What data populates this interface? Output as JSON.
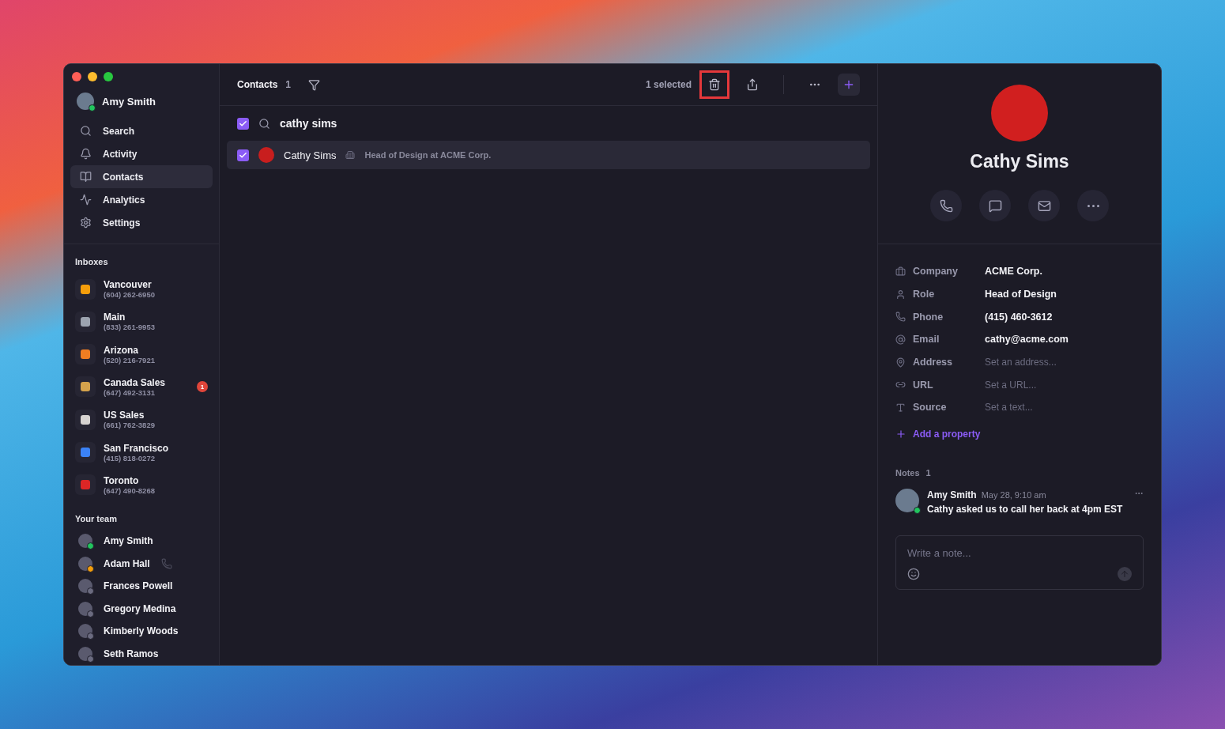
{
  "window": {
    "user": {
      "name": "Amy Smith",
      "online": true
    }
  },
  "sidebar": {
    "items": [
      {
        "kind": "search",
        "label": "Search",
        "selected": false
      },
      {
        "kind": "activity",
        "label": "Activity",
        "selected": false
      },
      {
        "kind": "contacts",
        "label": "Contacts",
        "selected": true
      },
      {
        "kind": "analytics",
        "label": "Analytics",
        "selected": false
      },
      {
        "kind": "settings",
        "label": "Settings",
        "selected": false
      }
    ],
    "inboxes_title": "Inboxes",
    "inboxes": [
      {
        "name": "Vancouver",
        "phone": "(604) 262-6950",
        "color": "#f59e0b"
      },
      {
        "name": "Main",
        "phone": "(833) 261-9953",
        "color": "#9ca3af"
      },
      {
        "name": "Arizona",
        "phone": "(520) 216-7921",
        "color": "#ef7d22"
      },
      {
        "name": "Canada Sales",
        "phone": "(647) 492-3131",
        "color": "#d4a24c",
        "badge": "1"
      },
      {
        "name": "US Sales",
        "phone": "(661) 762-3829",
        "color": "#d6d3d1"
      },
      {
        "name": "San Francisco",
        "phone": "(415) 818-0272",
        "color": "#3b82f6"
      },
      {
        "name": "Toronto",
        "phone": "(647) 490-8268",
        "color": "#dc2626"
      }
    ],
    "team_title": "Your team",
    "team": [
      {
        "name": "Amy Smith",
        "color": "#22c55e",
        "on_call": false
      },
      {
        "name": "Adam Hall",
        "color": "#f59e0b",
        "on_call": true
      },
      {
        "name": "Frances Powell",
        "color": "#6b6b80",
        "on_call": false
      },
      {
        "name": "Gregory Medina",
        "color": "#6b6b80",
        "on_call": false
      },
      {
        "name": "Kimberly Woods",
        "color": "#6b6b80",
        "on_call": false
      },
      {
        "name": "Seth Ramos",
        "color": "#6b6b80",
        "on_call": false
      }
    ]
  },
  "toolbar": {
    "title": "Contacts",
    "count": "1",
    "selection": "1 selected",
    "delete_highlighted": true
  },
  "search": {
    "checked": true,
    "value": "cathy sims"
  },
  "contacts": [
    {
      "name": "Cathy Sims",
      "subtitle": "Head of Design at ACME Corp.",
      "checked": true,
      "selected": true
    }
  ],
  "detail": {
    "name": "Cathy Sims",
    "properties": [
      {
        "kind": "company",
        "label": "Company",
        "value": "ACME Corp."
      },
      {
        "kind": "role",
        "label": "Role",
        "value": "Head of Design"
      },
      {
        "kind": "phone",
        "label": "Phone",
        "value": "(415) 460-3612"
      },
      {
        "kind": "email",
        "label": "Email",
        "value": "cathy@acme.com"
      },
      {
        "kind": "address",
        "label": "Address",
        "placeholder": "Set an address..."
      },
      {
        "kind": "url",
        "label": "URL",
        "placeholder": "Set a URL..."
      },
      {
        "kind": "source",
        "label": "Source",
        "placeholder": "Set a text..."
      }
    ],
    "add_property": "Add a property",
    "notes_title": "Notes",
    "notes_count": "1",
    "notes": [
      {
        "author": "Amy Smith",
        "time": "May 28, 9:10 am",
        "text": "Cathy asked us to call her back at 4pm EST",
        "online": true
      }
    ],
    "note_input": {
      "placeholder": "Write a note..."
    }
  }
}
